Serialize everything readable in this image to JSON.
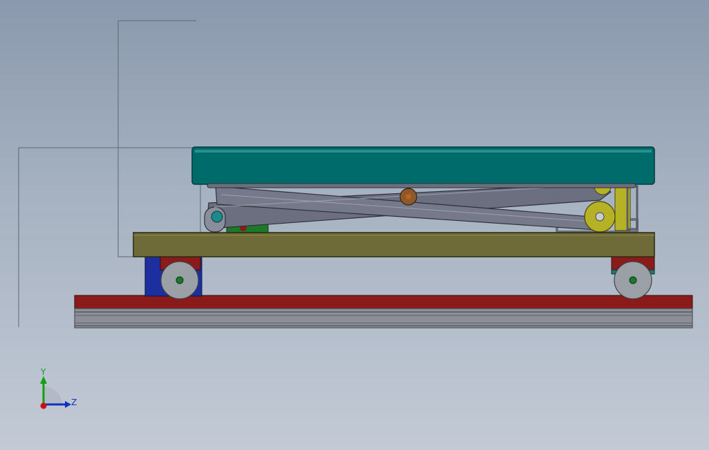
{
  "triad": {
    "y_label": "Y",
    "z_label": "Z"
  },
  "colors": {
    "background_top": "#8a99ad",
    "background_bottom": "#c3cad6",
    "table_top": "#006b6b",
    "scissor_arm": "#6b6f80",
    "base_frame": "#6e6b38",
    "rail_top": "#8b1a1a",
    "rail_profile": "#8c8f97",
    "wheel": "#9aa0a6",
    "hydraulic_cylinder": "#b6b226",
    "axis_x": "#d01010",
    "axis_y": "#10a010",
    "axis_z": "#1030c0"
  }
}
